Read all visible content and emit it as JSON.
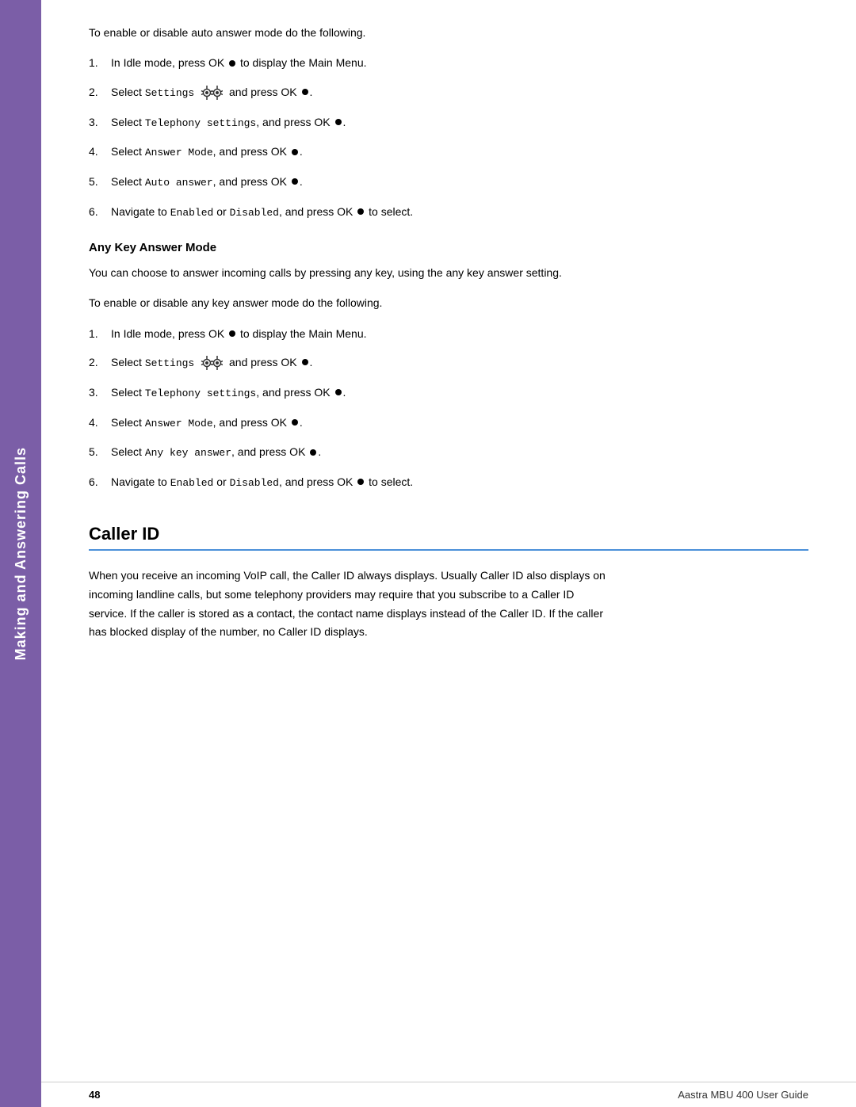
{
  "sidebar": {
    "label": "Making and Answering Calls"
  },
  "section1": {
    "intro": "To enable or disable auto answer mode do the following.",
    "steps": [
      "In Idle mode, press OK ● to display the Main Menu.",
      "Select Settings  and press OK ●.",
      "Select Telephony settings, and press OK ●.",
      "Select Answer Mode, and press OK ●.",
      "Select Auto answer, and press OK ●.",
      "Navigate to Enabled or Disabled, and press OK ● to select."
    ]
  },
  "any_key_section": {
    "heading": "Any Key Answer Mode",
    "para1": "You can choose to answer incoming calls by pressing any key, using the any key answer setting.",
    "para2": "To enable or disable any key answer mode do the following.",
    "steps": [
      "In Idle mode, press OK ● to display the Main Menu.",
      "Select Settings  and press OK ●.",
      "Select Telephony settings, and press OK ●.",
      "Select Answer Mode, and press OK ●.",
      "Select Any key answer, and press OK ●.",
      "Navigate to Enabled or Disabled, and press OK ● to select."
    ]
  },
  "caller_id_section": {
    "heading": "Caller ID",
    "para": "When you receive an incoming VoIP call, the Caller ID always displays. Usually Caller ID also displays on incoming landline calls, but some telephony providers may require that you subscribe to a Caller ID service. If the caller is stored as a contact, the contact name displays instead of the Caller ID. If the caller has blocked display of the number, no Caller ID displays."
  },
  "footer": {
    "page_number": "48",
    "guide_name": "Aastra MBU 400 User Guide"
  }
}
